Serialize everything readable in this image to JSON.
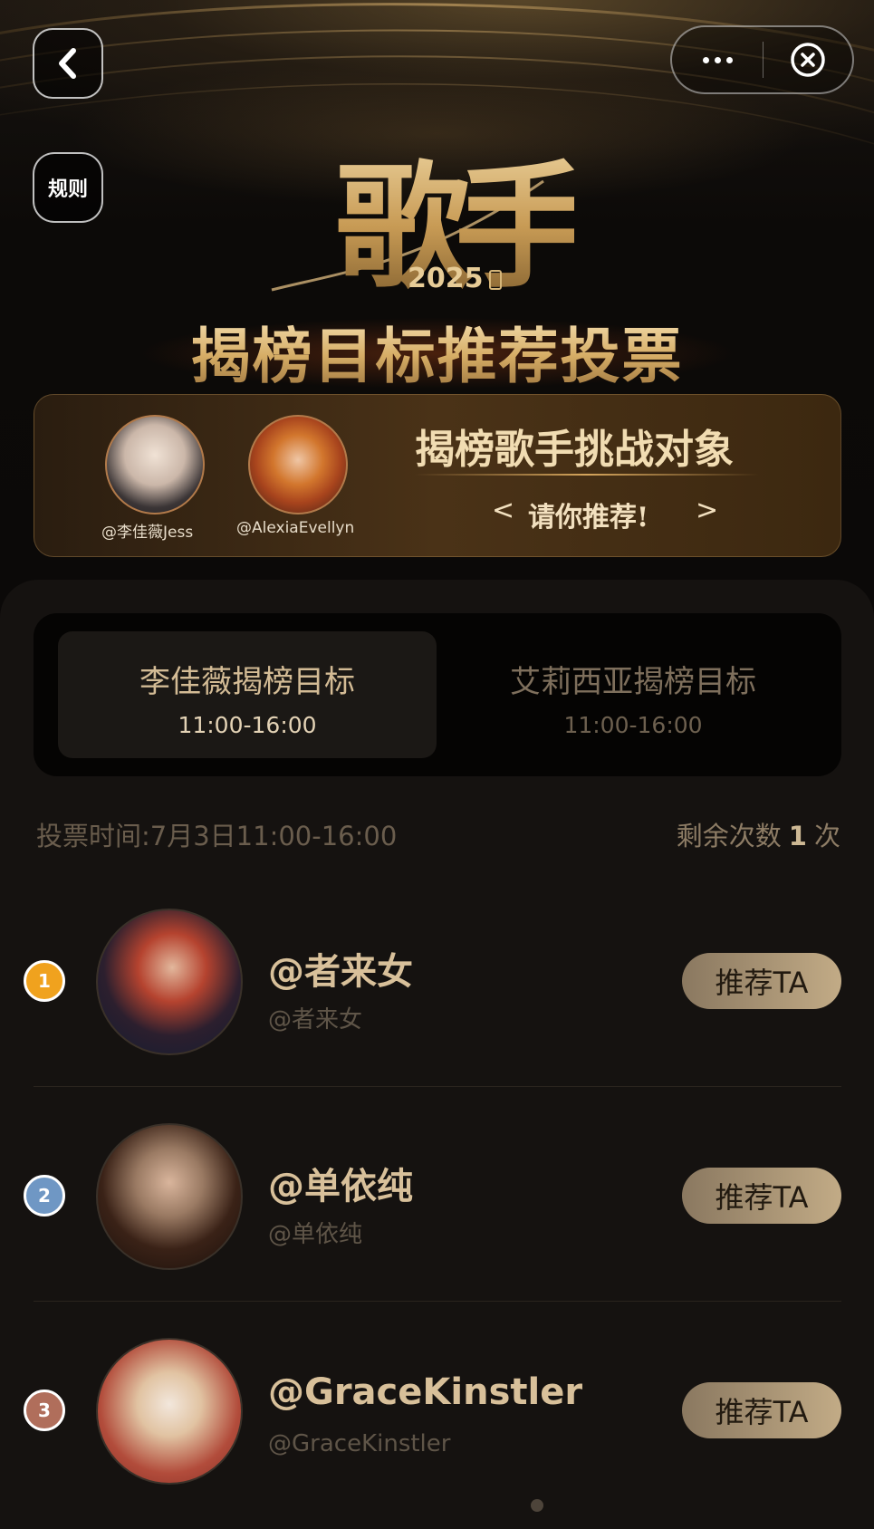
{
  "header": {
    "rules_label": "规则",
    "logo": {
      "text": "歌手",
      "year": "2025"
    },
    "title": "揭榜目标推荐投票"
  },
  "banner": {
    "singers": [
      {
        "handle": "@李佳薇Jess"
      },
      {
        "handle": "@AlexiaEvellyn"
      }
    ],
    "title": "揭榜歌手挑战对象",
    "subtitle": "请你推荐!",
    "chevron_left": "<",
    "chevron_right": ">"
  },
  "tabs": [
    {
      "title": "李佳薇揭榜目标",
      "time": "11:00-16:00",
      "active": true
    },
    {
      "title": "艾莉西亚揭榜目标",
      "time": "11:00-16:00",
      "active": false
    }
  ],
  "vote_info": {
    "time_label": "投票时间:7月3日11:00-16:00",
    "remaining_prefix": "剩余次数",
    "remaining_count": "1",
    "remaining_suffix": "次"
  },
  "candidates": [
    {
      "rank": "1",
      "rank_color": "#f0a21e",
      "name": "@者来女",
      "handle": "@者来女",
      "button": "推荐TA"
    },
    {
      "rank": "2",
      "rank_color": "#6f97c4",
      "name": "@单依纯",
      "handle": "@单依纯",
      "button": "推荐TA"
    },
    {
      "rank": "3",
      "rank_color": "#b06e5b",
      "name": "@GraceKinstler",
      "handle": "@GraceKinstler",
      "button": "推荐TA"
    }
  ],
  "icons": {
    "back": "chevron-left-icon",
    "more": "more-dots-icon",
    "close": "close-circle-icon"
  }
}
